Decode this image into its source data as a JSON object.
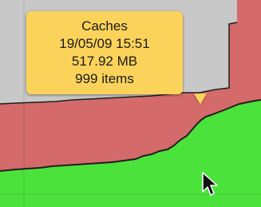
{
  "tooltip": {
    "name": "Caches",
    "date": "19/05/09 15:51",
    "size": "517.92 MB",
    "items": "999 items"
  },
  "colors": {
    "gray_band": "#c8c8c8",
    "red_band": "#d46a6a",
    "green_band": "#4ce23c",
    "tooltip_bg": "#fbd35a",
    "outline": "#1f1f1f"
  },
  "icons": {
    "cursor": "arrow-pointer-icon"
  }
}
